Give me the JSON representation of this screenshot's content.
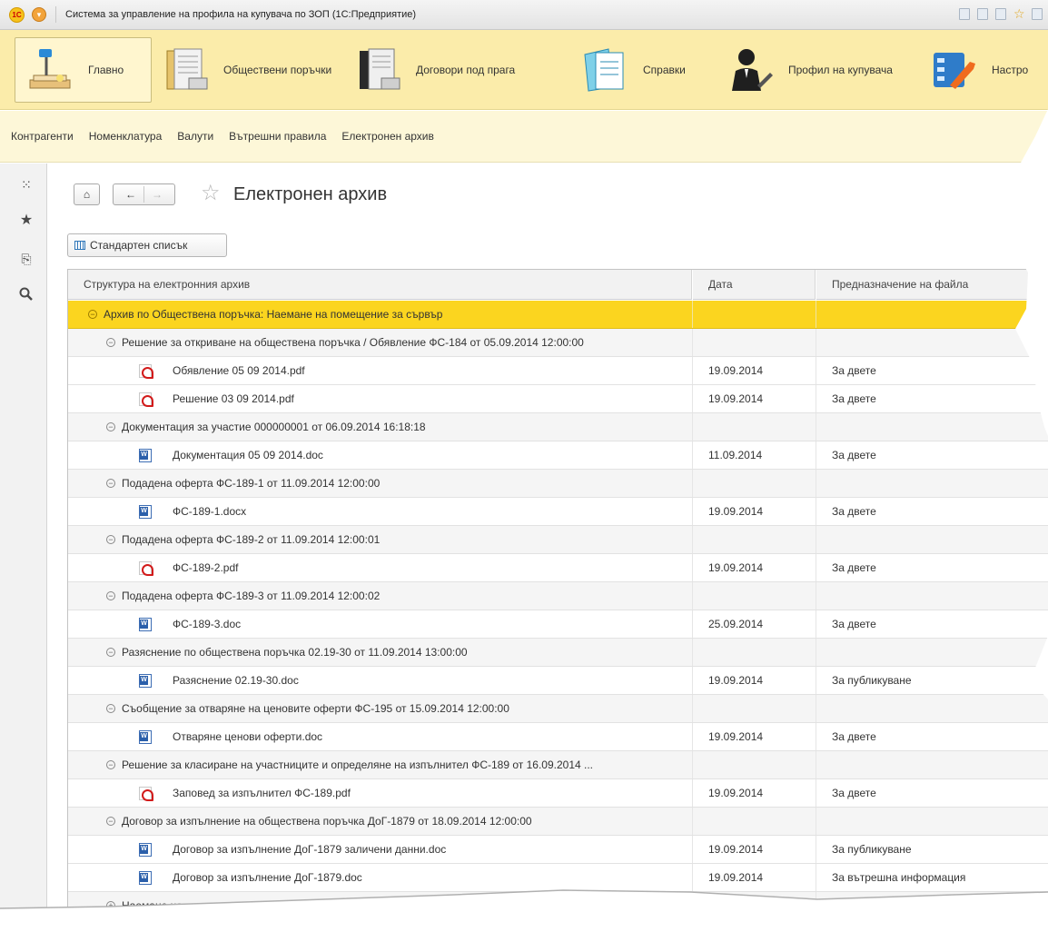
{
  "window": {
    "title": "Система за управление на профила на купувача по ЗОП  (1С:Предприятие)",
    "logo_text": "1С"
  },
  "sections": [
    {
      "label": "Главно",
      "icon": "desk-lamp-icon",
      "active": true
    },
    {
      "label": "Обществени поръчки",
      "icon": "document-folders-icon"
    },
    {
      "label": "Договори под прага",
      "icon": "document-folders-dark-icon"
    },
    {
      "label": "Справки",
      "icon": "report-document-icon"
    },
    {
      "label": "Профил на купувача",
      "icon": "businessman-icon"
    },
    {
      "label": "Настро",
      "icon": "settings-wrench-icon"
    }
  ],
  "functions": [
    "Контрагенти",
    "Номенклатура",
    "Валути",
    "Вътрешни правила",
    "Електронен архив"
  ],
  "form": {
    "title": "Електронен архив",
    "std_list_label": "Стандартен списък"
  },
  "table": {
    "headers": [
      "Структура на електронния архив",
      "Дата",
      "Предназначение на файла"
    ],
    "rows": [
      {
        "kind": "top",
        "text": "Архив по Обществена поръчка: Наемане на помещение за сървър",
        "date": "",
        "purpose": "",
        "toggle": "⊖"
      },
      {
        "kind": "group",
        "text": "Решение за откриване на обществена поръчка / Обявление ФС-184 от 05.09.2014 12:00:00",
        "date": "",
        "purpose": "",
        "toggle": "⊖"
      },
      {
        "kind": "file",
        "icon": "pdf",
        "text": "Обявление 05 09 2014.pdf",
        "date": "19.09.2014",
        "purpose": "За двете"
      },
      {
        "kind": "file",
        "icon": "pdf",
        "text": "Решение 03 09 2014.pdf",
        "date": "19.09.2014",
        "purpose": "За двете"
      },
      {
        "kind": "group",
        "text": "Документация за участие 000000001 от 06.09.2014 16:18:18",
        "date": "",
        "purpose": "",
        "toggle": "⊖"
      },
      {
        "kind": "file",
        "icon": "doc",
        "text": "Документация 05 09 2014.doc",
        "date": "11.09.2014",
        "purpose": "За двете"
      },
      {
        "kind": "group",
        "text": "Подадена оферта ФС-189-1 от 11.09.2014 12:00:00",
        "date": "",
        "purpose": "",
        "toggle": "⊖"
      },
      {
        "kind": "file",
        "icon": "doc",
        "text": "ФС-189-1.docx",
        "date": "19.09.2014",
        "purpose": "За двете"
      },
      {
        "kind": "group",
        "text": "Подадена оферта ФС-189-2 от 11.09.2014 12:00:01",
        "date": "",
        "purpose": "",
        "toggle": "⊖"
      },
      {
        "kind": "file",
        "icon": "pdf",
        "text": "ФС-189-2.pdf",
        "date": "19.09.2014",
        "purpose": "За двете"
      },
      {
        "kind": "group",
        "text": "Подадена оферта ФС-189-3 от 11.09.2014 12:00:02",
        "date": "",
        "purpose": "",
        "toggle": "⊖"
      },
      {
        "kind": "file",
        "icon": "doc",
        "text": "ФС-189-3.doc",
        "date": "25.09.2014",
        "purpose": "За двете"
      },
      {
        "kind": "group",
        "text": "Разяснение по обществена поръчка 02.19-30 от 11.09.2014 13:00:00",
        "date": "",
        "purpose": "",
        "toggle": "⊖"
      },
      {
        "kind": "file",
        "icon": "doc",
        "text": "Разяснение 02.19-30.doc",
        "date": "19.09.2014",
        "purpose": "За публикуване"
      },
      {
        "kind": "group",
        "text": "Съобщение за отваряне на ценовите оферти ФС-195 от 15.09.2014 12:00:00",
        "date": "",
        "purpose": "",
        "toggle": "⊖"
      },
      {
        "kind": "file",
        "icon": "doc",
        "text": "Отваряне ценови оферти.doc",
        "date": "19.09.2014",
        "purpose": "За двете"
      },
      {
        "kind": "group",
        "text": "Решение за класиране на участниците и определяне на изпълнител ФС-189 от 16.09.2014 ...",
        "date": "",
        "purpose": "",
        "toggle": "⊖"
      },
      {
        "kind": "file",
        "icon": "pdf",
        "text": "Заповед за изпълнител ФС-189.pdf",
        "date": "19.09.2014",
        "purpose": "За двете"
      },
      {
        "kind": "group",
        "text": "Договор за изпълнение на обществена поръчка ДоГ-1879 от 18.09.2014 12:00:00",
        "date": "",
        "purpose": "",
        "toggle": "⊖"
      },
      {
        "kind": "file",
        "icon": "doc",
        "text": "Договор за изпълнение ДоГ-1879 заличени данни.doc",
        "date": "19.09.2014",
        "purpose": "За публикуване"
      },
      {
        "kind": "file",
        "icon": "doc",
        "text": "Договор за изпълнение ДоГ-1879.doc",
        "date": "19.09.2014",
        "purpose": "За вътрешна информация"
      },
      {
        "kind": "group",
        "text": "Наемане на помещение за сървър",
        "date": "",
        "purpose": "",
        "toggle": "⊕"
      }
    ]
  },
  "colors": {
    "sections_bg": "#fbecaa",
    "function_bg": "#fdf7d8",
    "selected_row": "#fbd51f"
  }
}
